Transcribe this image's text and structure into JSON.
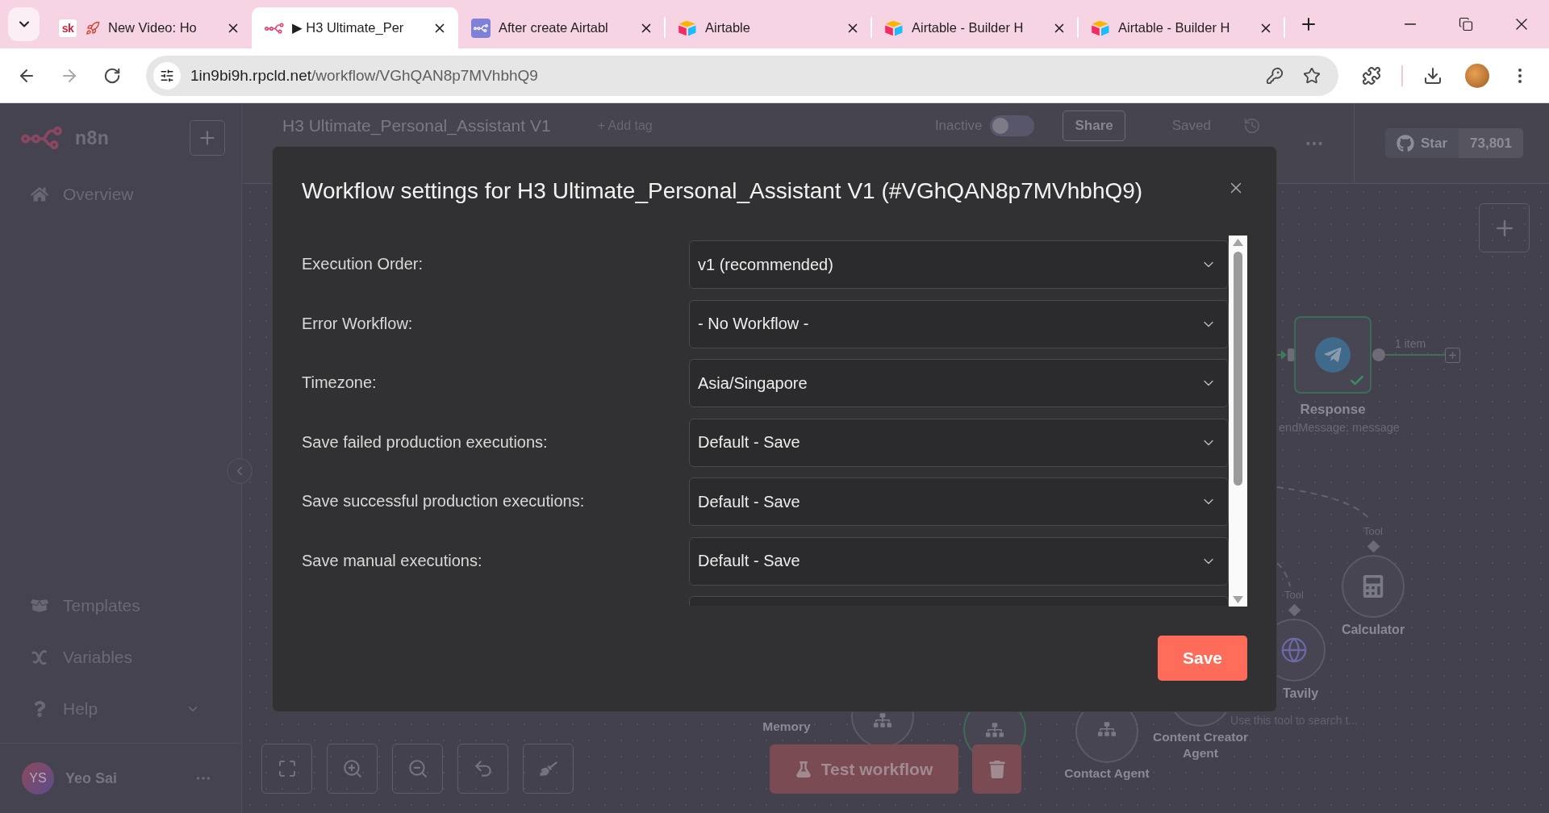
{
  "browser": {
    "tabs": [
      {
        "kind": "text_logo",
        "logo_text": "sk",
        "title": "New Video: Ho",
        "selected": false
      },
      {
        "kind": "n8n",
        "title": "▶ H3 Ultimate_Per",
        "selected": true
      },
      {
        "kind": "n8n_tile",
        "title": "After create Airtabl",
        "selected": false
      },
      {
        "kind": "airtable",
        "title": "Airtable",
        "selected": false
      },
      {
        "kind": "airtable",
        "title": "Airtable - Builder H",
        "selected": false
      },
      {
        "kind": "airtable",
        "title": "Airtable - Builder H",
        "selected": false
      }
    ],
    "address": {
      "host": "1in9bi9h.rpcld.net",
      "path": "/workflow/VGhQAN8p7MVhbhQ9"
    }
  },
  "sidebar": {
    "brand": "n8n",
    "nav_top": [
      {
        "kind": "home",
        "label": "Overview"
      }
    ],
    "nav_bottom": [
      {
        "kind": "templates",
        "label": "Templates"
      },
      {
        "kind": "variables",
        "label": "Variables"
      },
      {
        "kind": "help",
        "label": "Help"
      }
    ],
    "user": {
      "initials": "YS",
      "name": "Yeo Sai"
    }
  },
  "header": {
    "workflow_name": "H3 Ultimate_Personal_Assistant V1",
    "add_tag": "+ Add tag",
    "status_label": "Inactive",
    "active": false,
    "share": "Share",
    "save_state": "Saved",
    "github": {
      "label": "Star",
      "count": "73,801"
    }
  },
  "canvas": {
    "nodes": [
      {
        "kind": "action",
        "label": "Response",
        "subtitle": "endMessage: message",
        "output_label": "1 item",
        "success": true
      },
      {
        "kind": "tool",
        "label": "Calculator",
        "port_label": "Tool",
        "success": false
      },
      {
        "kind": "tool",
        "label": "Tavily",
        "subtitle": "Use this tool to search t...",
        "port_label": "Tool",
        "success": false
      },
      {
        "kind": "label",
        "label": "Memory"
      },
      {
        "kind": "agent",
        "success": false
      },
      {
        "kind": "agent",
        "success": true
      },
      {
        "kind": "agent",
        "label": "Contact Agent",
        "success": false
      },
      {
        "kind": "agent",
        "label": "Content Creator Agent",
        "success": false
      }
    ],
    "test_button": "Test workflow"
  },
  "modal": {
    "title": "Workflow settings for H3 Ultimate_Personal_Assistant V1 (#VGhQAN8p7MVhbhQ9)",
    "settings": [
      {
        "label": "Execution Order:",
        "value": "v1 (recommended)"
      },
      {
        "label": "Error Workflow:",
        "value": "- No Workflow -"
      },
      {
        "label": "Timezone:",
        "value": "Asia/Singapore"
      },
      {
        "label": "Save failed production executions:",
        "value": "Default - Save"
      },
      {
        "label": "Save successful production executions:",
        "value": "Default - Save"
      },
      {
        "label": "Save manual executions:",
        "value": "Default - Save"
      }
    ],
    "save": "Save"
  }
}
